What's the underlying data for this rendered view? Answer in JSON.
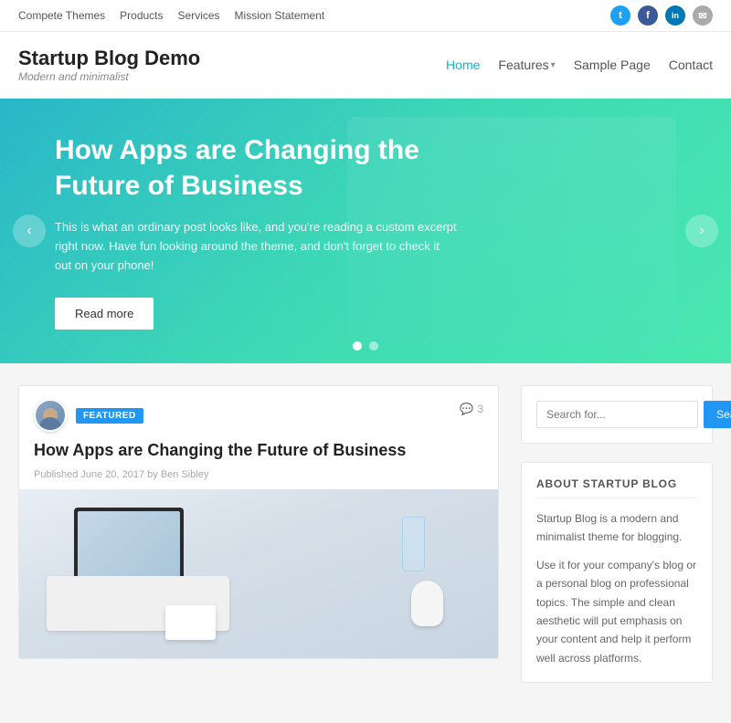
{
  "topbar": {
    "nav": [
      {
        "label": "Compete Themes",
        "id": "compete-themes"
      },
      {
        "label": "Products",
        "id": "products"
      },
      {
        "label": "Services",
        "id": "services"
      },
      {
        "label": "Mission Statement",
        "id": "mission-statement"
      }
    ],
    "socials": [
      {
        "name": "twitter",
        "icon": "t",
        "class": "social-twitter"
      },
      {
        "name": "facebook",
        "icon": "f",
        "class": "social-facebook"
      },
      {
        "name": "linkedin",
        "icon": "in",
        "class": "social-linkedin"
      },
      {
        "name": "email",
        "icon": "✉",
        "class": "social-email"
      }
    ]
  },
  "header": {
    "site_title": "Startup Blog Demo",
    "site_tagline": "Modern and minimalist",
    "nav": [
      {
        "label": "Home",
        "active": true,
        "id": "home"
      },
      {
        "label": "Features",
        "hasDropdown": true,
        "id": "features"
      },
      {
        "label": "Sample Page",
        "id": "sample-page"
      },
      {
        "label": "Contact",
        "id": "contact"
      }
    ]
  },
  "hero": {
    "title": "How Apps are Changing the Future of Business",
    "excerpt": "This is what an ordinary post looks like, and you're reading a custom excerpt right now. Have fun looking around the theme, and don't forget to check it out on your phone!",
    "read_more_label": "Read more",
    "prev_label": "‹",
    "next_label": "›",
    "dots": [
      {
        "active": true
      },
      {
        "active": false
      }
    ]
  },
  "post": {
    "featured_label": "FEATURED",
    "title": "How Apps are Changing the Future of Business",
    "comment_icon": "💬",
    "comment_count": "3",
    "published": "Published June 20, 2017 by Ben Sibley"
  },
  "sidebar": {
    "search_placeholder": "Search for...",
    "search_btn_label": "Search",
    "about_title": "ABOUT STARTUP BLOG",
    "about_text_1": "Startup Blog is a modern and minimalist theme for blogging.",
    "about_text_2": "Use it for your company's blog or a personal blog on professional topics. The simple and clean aesthetic will put emphasis on your content and help it perform well across platforms."
  }
}
